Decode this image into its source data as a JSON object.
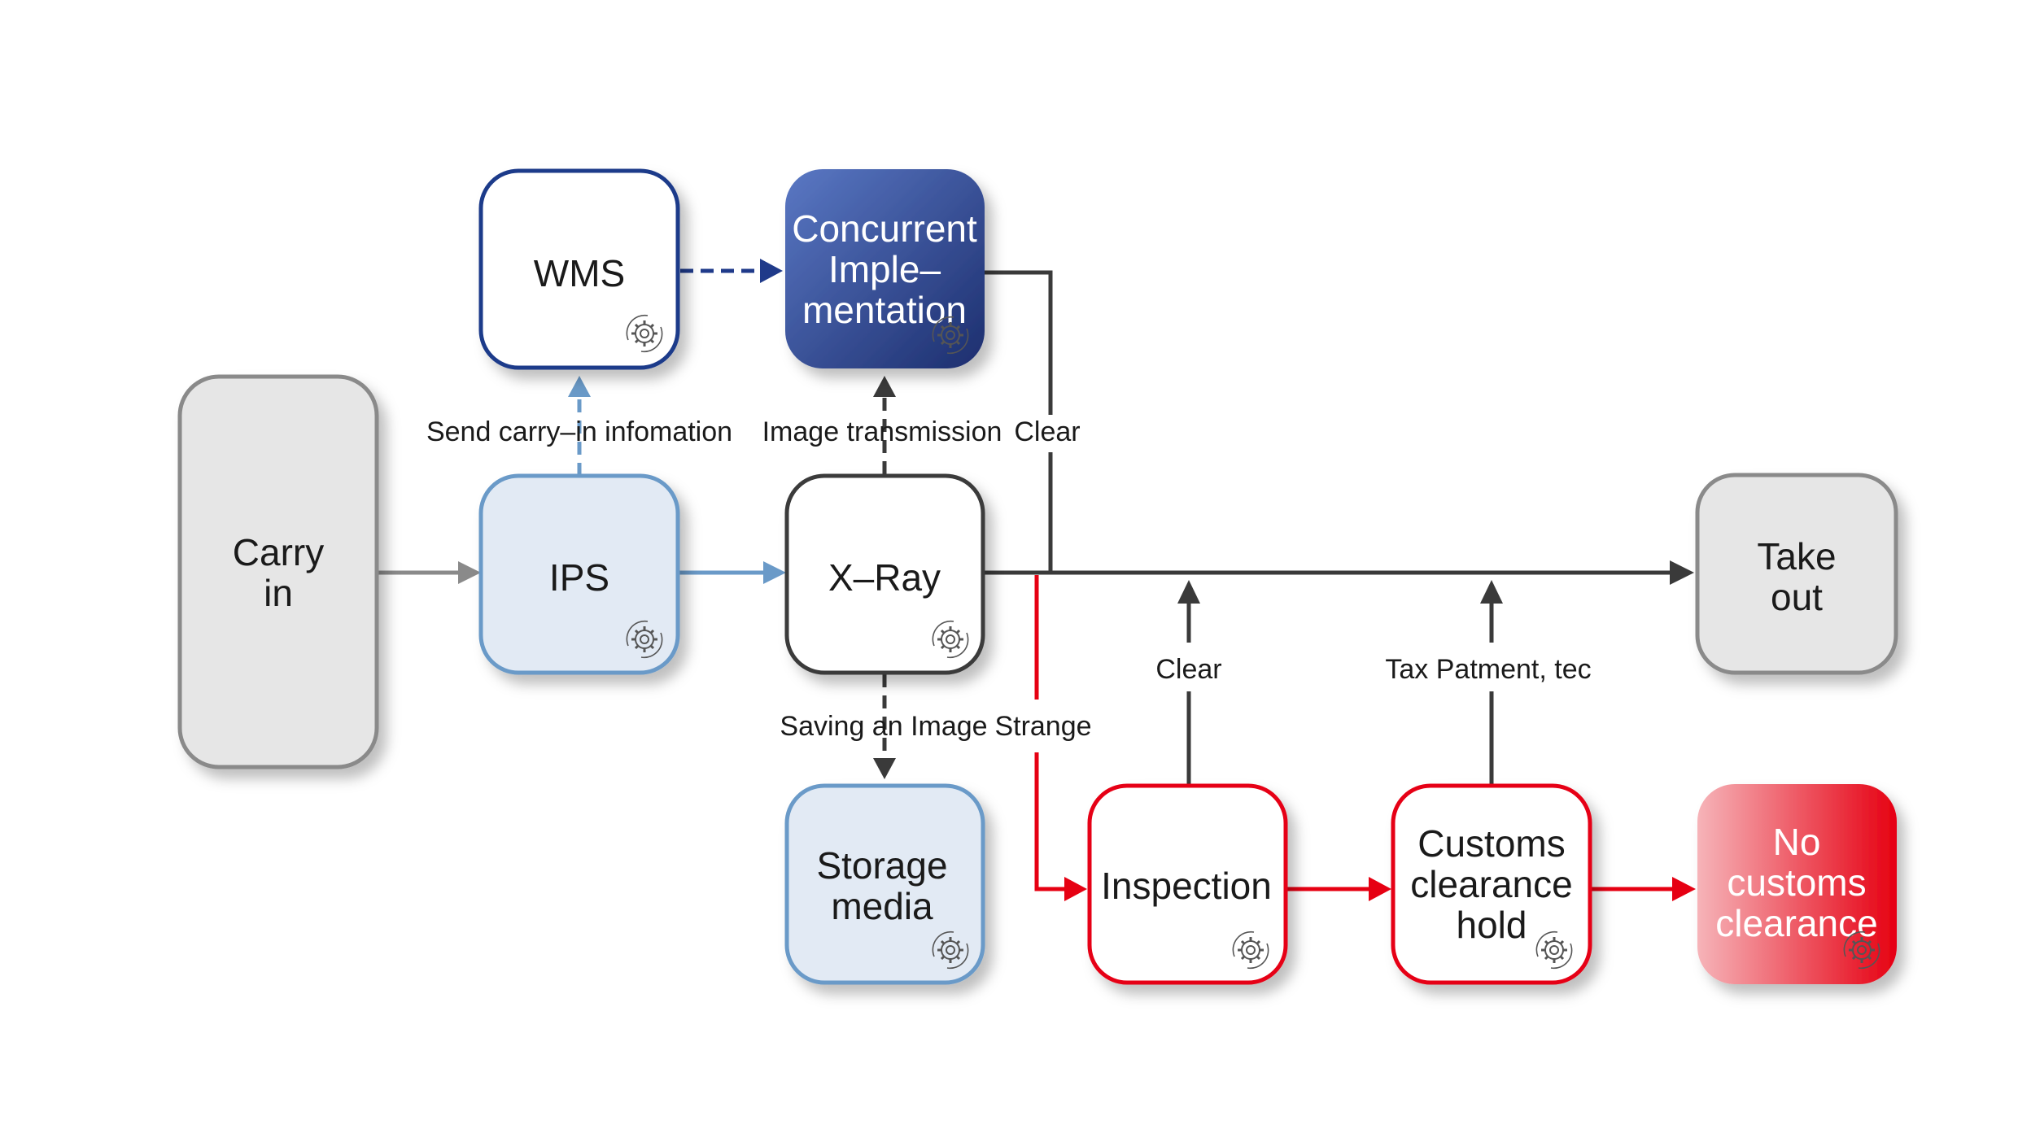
{
  "nodes": {
    "carry_in": [
      "Carry",
      "in"
    ],
    "ips": [
      "IPS"
    ],
    "wms": [
      "WMS"
    ],
    "concurrent": [
      "Concurrent",
      "Imple–",
      "mentation"
    ],
    "xray": [
      "X–Ray"
    ],
    "storage": [
      "Storage",
      "media"
    ],
    "take_out": [
      "Take",
      "out"
    ],
    "inspection": [
      "Inspection"
    ],
    "customs_hold": [
      "Customs",
      "clearance",
      "hold"
    ],
    "no_clearance": [
      "No",
      "customs",
      "clearance"
    ]
  },
  "edges": {
    "send_info": "Send carry–in infomation",
    "image_transmission": "Image transmission",
    "clear_top": "Clear",
    "saving_image": "Saving an Image",
    "strange": "Strange",
    "clear_inspection": "Clear",
    "tax_payment": "Tax Patment, tec"
  },
  "icons": {
    "process": "gear-cycle-icon"
  },
  "colors": {
    "gray": "#8a8a8a",
    "blue_light": "#6a9ac8",
    "navy": "#1f3a8a",
    "dark": "#3a3a3a",
    "red": "#e60012"
  }
}
